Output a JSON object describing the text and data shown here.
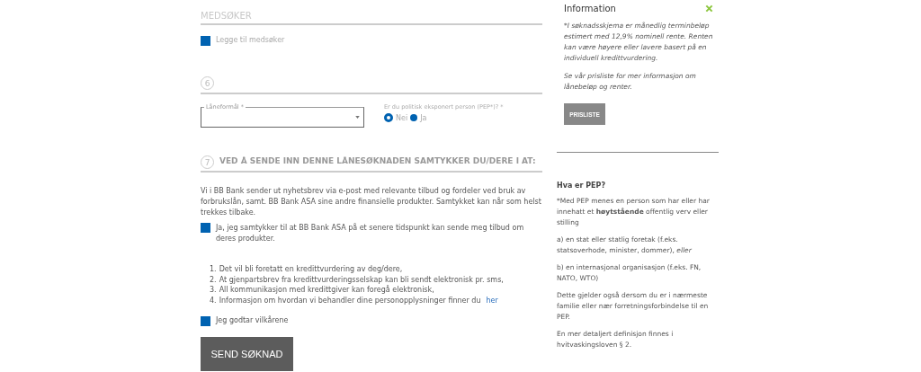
{
  "coapplicant": {
    "heading": "MEDSØKER",
    "checkbox": {
      "label": "Legge til medsøker",
      "checked": false
    }
  },
  "step6": {
    "number": "6",
    "loan_purpose": {
      "label": "Låneformål *"
    },
    "pep_question": {
      "label": "Er du politisk eksponert person (PEP*)? *",
      "options": [
        {
          "label": "Nei",
          "selected": true
        },
        {
          "label": "Ja",
          "selected": false
        }
      ]
    }
  },
  "step7": {
    "number": "7",
    "heading": "VED Å SENDE INN DENNE LÅNESØKNADEN SAMTYKKER DU/DERE I AT:",
    "paragraph": "Vi i BB Bank sender ut nyhetsbrev via e-post med relevante tilbud og fordeler ved bruk av forbrukslån, samt. BB Bank ASA sine andre finansielle produkter. Samtykket kan når som helst trekkes tilbake.",
    "consent_checkbox": {
      "label": "Ja, jeg samtykker til at BB Bank ASA på et senere tidspunkt kan sende meg tilbud om deres produkter.",
      "checked": false
    },
    "terms": [
      {
        "number": "1.",
        "text": "Det vil bli foretatt en kredittvurdering av deg/dere,"
      },
      {
        "number": "2.",
        "text": "At gjenpartsbrev fra kredittvurderingsselskap kan bli sendt elektronisk pr. sms,"
      },
      {
        "number": "3.",
        "text": "All kommunikasjon med kredittgiver kan foregå elektronisk,"
      },
      {
        "number": "4.",
        "text": "Informasjon om hvordan vi behandler dine personopplysninger finner du",
        "link": "her"
      }
    ],
    "accept_checkbox": {
      "label": "Jeg godtar vilkårene",
      "checked": false
    },
    "submit_button": "SEND SØKNAD"
  },
  "info_panel": {
    "title": "Information",
    "paragraphs": [
      "*I søknadsskjema er månedlig terminbeløp estimert med 12,9% nominell rente. Renten kan være høyere eller lavere basert på en individuell kredittvurdering.",
      "Se vår prisliste for mer informasjon om lånebeløp og renter."
    ],
    "button": "PRISLISTE"
  },
  "pep_info": {
    "title": "Hva er PEP?",
    "paragraphs": [
      "*Med PEP menes en person som har eller har innehatt et **høytstående** offentlig verv eller stilling",
      "a) en stat eller statlig foretak (f.eks. statsoverhode, minister, dommer), *eller*",
      "b) en internasjonal organisasjon (f.eks. FN, NATO, WTO)",
      "Dette gjelder også dersom du er i nærmeste familie eller nær forretningsforbindelse til en PEP.",
      "En mer detaljert definisjon finnes i hvitvaskingsloven § 2."
    ]
  }
}
